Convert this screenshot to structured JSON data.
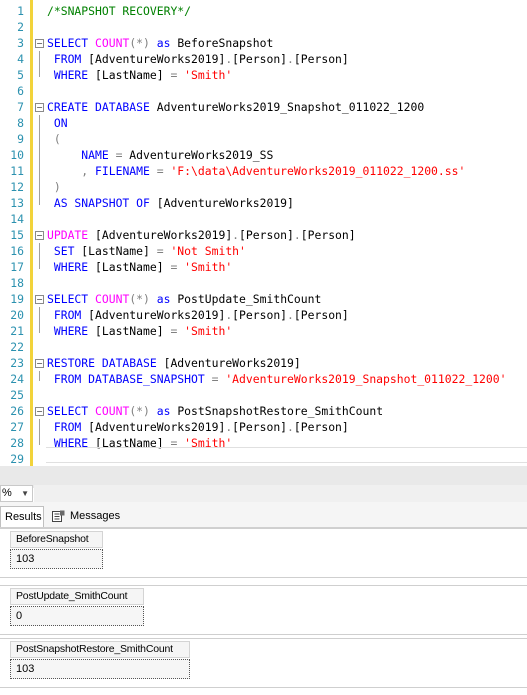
{
  "editor": {
    "lines": [
      {
        "n": "1",
        "parts": [
          {
            "t": "/*SNAPSHOT RECOVERY*/",
            "c": "cmt"
          }
        ]
      },
      {
        "n": "2",
        "parts": []
      },
      {
        "n": "3",
        "parts": [
          {
            "t": "SELECT ",
            "c": "kw"
          },
          {
            "t": "COUNT",
            "c": "fn"
          },
          {
            "t": "(*)",
            "c": "op"
          },
          {
            "t": " as ",
            "c": "kw"
          },
          {
            "t": "BeforeSnapshot",
            "c": "id"
          }
        ]
      },
      {
        "n": "4",
        "parts": [
          {
            "t": " FROM ",
            "c": "kw"
          },
          {
            "t": "[AdventureWorks2019]",
            "c": "id"
          },
          {
            "t": ".",
            "c": "op"
          },
          {
            "t": "[Person]",
            "c": "id"
          },
          {
            "t": ".",
            "c": "op"
          },
          {
            "t": "[Person]",
            "c": "id"
          }
        ]
      },
      {
        "n": "5",
        "parts": [
          {
            "t": " WHERE ",
            "c": "kw"
          },
          {
            "t": "[LastName] ",
            "c": "id"
          },
          {
            "t": "=",
            "c": "op"
          },
          {
            "t": " ",
            "c": "id"
          },
          {
            "t": "'Smith'",
            "c": "str"
          }
        ]
      },
      {
        "n": "6",
        "parts": []
      },
      {
        "n": "7",
        "parts": [
          {
            "t": "CREATE DATABASE ",
            "c": "kw"
          },
          {
            "t": "AdventureWorks2019_Snapshot_011022_1200",
            "c": "id"
          }
        ]
      },
      {
        "n": "8",
        "parts": [
          {
            "t": " ON",
            "c": "kw"
          }
        ]
      },
      {
        "n": "9",
        "parts": [
          {
            "t": " (",
            "c": "op"
          }
        ]
      },
      {
        "n": "10",
        "parts": [
          {
            "t": "     NAME ",
            "c": "kw"
          },
          {
            "t": "=",
            "c": "op"
          },
          {
            "t": " AdventureWorks2019_SS",
            "c": "id"
          }
        ]
      },
      {
        "n": "11",
        "parts": [
          {
            "t": "     ,",
            "c": "op"
          },
          {
            "t": " FILENAME ",
            "c": "kw"
          },
          {
            "t": "=",
            "c": "op"
          },
          {
            "t": " ",
            "c": "id"
          },
          {
            "t": "'F:\\data\\AdventureWorks2019_011022_1200.ss'",
            "c": "str"
          }
        ]
      },
      {
        "n": "12",
        "parts": [
          {
            "t": " )",
            "c": "op"
          }
        ]
      },
      {
        "n": "13",
        "parts": [
          {
            "t": " AS SNAPSHOT OF ",
            "c": "kw"
          },
          {
            "t": "[AdventureWorks2019]",
            "c": "id"
          }
        ]
      },
      {
        "n": "14",
        "parts": []
      },
      {
        "n": "15",
        "parts": [
          {
            "t": "UPDATE ",
            "c": "fn"
          },
          {
            "t": "[AdventureWorks2019]",
            "c": "id"
          },
          {
            "t": ".",
            "c": "op"
          },
          {
            "t": "[Person]",
            "c": "id"
          },
          {
            "t": ".",
            "c": "op"
          },
          {
            "t": "[Person]",
            "c": "id"
          }
        ]
      },
      {
        "n": "16",
        "parts": [
          {
            "t": " SET ",
            "c": "kw"
          },
          {
            "t": "[LastName] ",
            "c": "id"
          },
          {
            "t": "=",
            "c": "op"
          },
          {
            "t": " ",
            "c": "id"
          },
          {
            "t": "'Not Smith'",
            "c": "str"
          }
        ]
      },
      {
        "n": "17",
        "parts": [
          {
            "t": " WHERE ",
            "c": "kw"
          },
          {
            "t": "[LastName] ",
            "c": "id"
          },
          {
            "t": "=",
            "c": "op"
          },
          {
            "t": " ",
            "c": "id"
          },
          {
            "t": "'Smith'",
            "c": "str"
          }
        ]
      },
      {
        "n": "18",
        "parts": []
      },
      {
        "n": "19",
        "parts": [
          {
            "t": "SELECT ",
            "c": "kw"
          },
          {
            "t": "COUNT",
            "c": "fn"
          },
          {
            "t": "(*)",
            "c": "op"
          },
          {
            "t": " as ",
            "c": "kw"
          },
          {
            "t": "PostUpdate_SmithCount",
            "c": "id"
          }
        ]
      },
      {
        "n": "20",
        "parts": [
          {
            "t": " FROM ",
            "c": "kw"
          },
          {
            "t": "[AdventureWorks2019]",
            "c": "id"
          },
          {
            "t": ".",
            "c": "op"
          },
          {
            "t": "[Person]",
            "c": "id"
          },
          {
            "t": ".",
            "c": "op"
          },
          {
            "t": "[Person]",
            "c": "id"
          }
        ]
      },
      {
        "n": "21",
        "parts": [
          {
            "t": " WHERE ",
            "c": "kw"
          },
          {
            "t": "[LastName] ",
            "c": "id"
          },
          {
            "t": "=",
            "c": "op"
          },
          {
            "t": " ",
            "c": "id"
          },
          {
            "t": "'Smith'",
            "c": "str"
          }
        ]
      },
      {
        "n": "22",
        "parts": []
      },
      {
        "n": "23",
        "parts": [
          {
            "t": "RESTORE DATABASE ",
            "c": "kw"
          },
          {
            "t": "[AdventureWorks2019]",
            "c": "id"
          }
        ]
      },
      {
        "n": "24",
        "parts": [
          {
            "t": " FROM DATABASE_SNAPSHOT ",
            "c": "kw"
          },
          {
            "t": "=",
            "c": "op"
          },
          {
            "t": " ",
            "c": "id"
          },
          {
            "t": "'AdventureWorks2019_Snapshot_011022_1200'",
            "c": "str"
          }
        ]
      },
      {
        "n": "25",
        "parts": []
      },
      {
        "n": "26",
        "parts": [
          {
            "t": "SELECT ",
            "c": "kw"
          },
          {
            "t": "COUNT",
            "c": "fn"
          },
          {
            "t": "(*)",
            "c": "op"
          },
          {
            "t": " as ",
            "c": "kw"
          },
          {
            "t": "PostSnapshotRestore_SmithCount",
            "c": "id"
          }
        ]
      },
      {
        "n": "27",
        "parts": [
          {
            "t": " FROM ",
            "c": "kw"
          },
          {
            "t": "[AdventureWorks2019]",
            "c": "id"
          },
          {
            "t": ".",
            "c": "op"
          },
          {
            "t": "[Person]",
            "c": "id"
          },
          {
            "t": ".",
            "c": "op"
          },
          {
            "t": "[Person]",
            "c": "id"
          }
        ]
      },
      {
        "n": "28",
        "parts": [
          {
            "t": " WHERE ",
            "c": "kw"
          },
          {
            "t": "[LastName] ",
            "c": "id"
          },
          {
            "t": "=",
            "c": "op"
          },
          {
            "t": " ",
            "c": "id"
          },
          {
            "t": "'Smith'",
            "c": "str"
          }
        ]
      },
      {
        "n": "29",
        "parts": []
      }
    ]
  },
  "zoom": {
    "value": "%"
  },
  "tabs": {
    "results": "Results",
    "messages": "Messages"
  },
  "results": [
    {
      "column": "BeforeSnapshot",
      "value": "103"
    },
    {
      "column": "PostUpdate_SmithCount",
      "value": "0"
    },
    {
      "column": "PostSnapshotRestore_SmithCount",
      "value": "103"
    }
  ],
  "colors": {
    "keyword": "#0000ff",
    "function": "#ff00ff",
    "string": "#ff0000",
    "comment": "#008000",
    "operator": "#808080",
    "line_number": "#2b91af",
    "change_margin": "#f2d33a"
  }
}
